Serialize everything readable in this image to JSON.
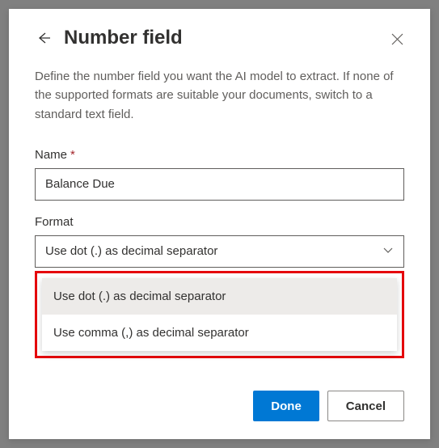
{
  "dialog": {
    "title": "Number field",
    "description": "Define the number field you want the AI model to extract. If none of the supported formats are suitable your documents, switch to a standard text field."
  },
  "name_field": {
    "label": "Name",
    "required_mark": "*",
    "value": "Balance Due"
  },
  "format_field": {
    "label": "Format",
    "selected": "Use dot (.) as decimal separator",
    "options": [
      "Use dot (.) as decimal separator",
      "Use comma (,) as decimal separator"
    ]
  },
  "buttons": {
    "primary": "Done",
    "secondary": "Cancel"
  }
}
